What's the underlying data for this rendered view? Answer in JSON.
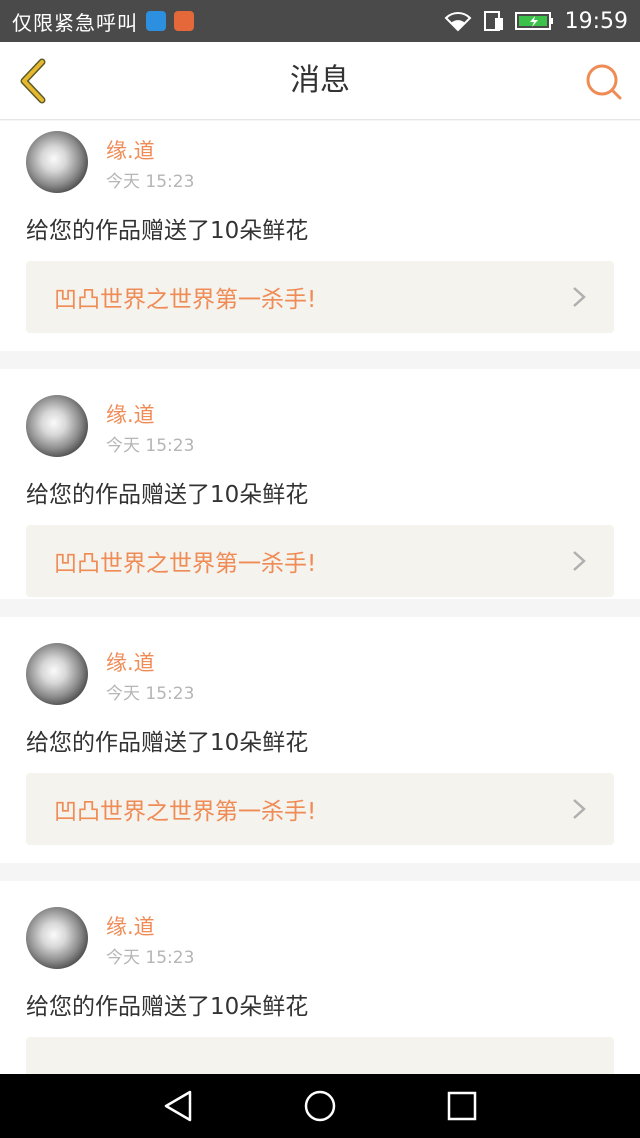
{
  "status_bar": {
    "carrier": "仅限紧急呼叫",
    "time": "19:59"
  },
  "nav": {
    "title": "消息",
    "back_icon": "chevron-left-icon",
    "search_icon": "search-icon"
  },
  "colors": {
    "accent": "#ef8b55",
    "back_icon": "#e6b82e",
    "card_link_bg": "#f4f3ee"
  },
  "messages": [
    {
      "user": "缘.道",
      "time": "今天 15:23",
      "text": "给您的作品赠送了10朵鲜花",
      "work": "凹凸世界之世界第一杀手!"
    },
    {
      "user": "缘.道",
      "time": "今天 15:23",
      "text": "给您的作品赠送了10朵鲜花",
      "work": "凹凸世界之世界第一杀手!"
    },
    {
      "user": "缘.道",
      "time": "今天 15:23",
      "text": "给您的作品赠送了10朵鲜花",
      "work": "凹凸世界之世界第一杀手!"
    },
    {
      "user": "缘.道",
      "time": "今天 15:23",
      "text": "给您的作品赠送了10朵鲜花",
      "work": ""
    }
  ]
}
